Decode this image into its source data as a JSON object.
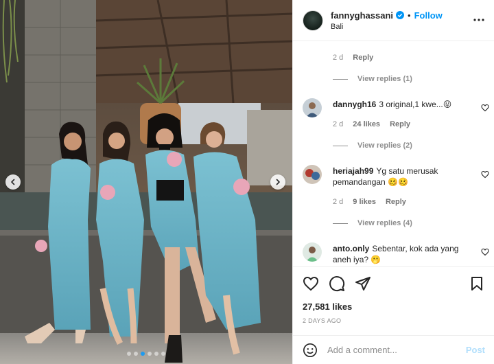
{
  "post": {
    "username": "fannyghassani",
    "follow_label": "Follow",
    "separator": "•",
    "location": "Bali",
    "carousel": {
      "slide_count": 6,
      "active_slide": 2
    }
  },
  "comments": {
    "first_meta": {
      "time": "2 d",
      "reply_label": "Reply"
    },
    "first_view_replies": "View replies (1)",
    "items": [
      {
        "username": "dannygh16",
        "text": "3 original,1 kwe...😛",
        "time": "2 d",
        "likes": "24 likes",
        "reply_label": "Reply",
        "view_replies": "View replies (2)"
      },
      {
        "username": "heriajah99",
        "text": "Yg satu merusak pemandangan 🥴🥴",
        "time": "2 d",
        "likes": "9 likes",
        "reply_label": "Reply",
        "view_replies": "View replies (4)"
      },
      {
        "username": "anto.only",
        "text": "Sebentar, kok ada yang aneh iya? 🫢"
      }
    ]
  },
  "actions": {
    "likes": "27,581 likes",
    "date": "2 DAYS AGO"
  },
  "add_comment": {
    "placeholder": "Add a comment...",
    "post_label": "Post"
  },
  "colors": {
    "accent": "#0095f6",
    "post_disabled": "#b2dffc",
    "dress": "#6fb6c9"
  },
  "icons": [
    "verified-icon",
    "more-icon",
    "chevron-left-icon",
    "chevron-right-icon",
    "heart-icon",
    "comment-icon",
    "share-icon",
    "bookmark-icon",
    "emoji-icon"
  ]
}
